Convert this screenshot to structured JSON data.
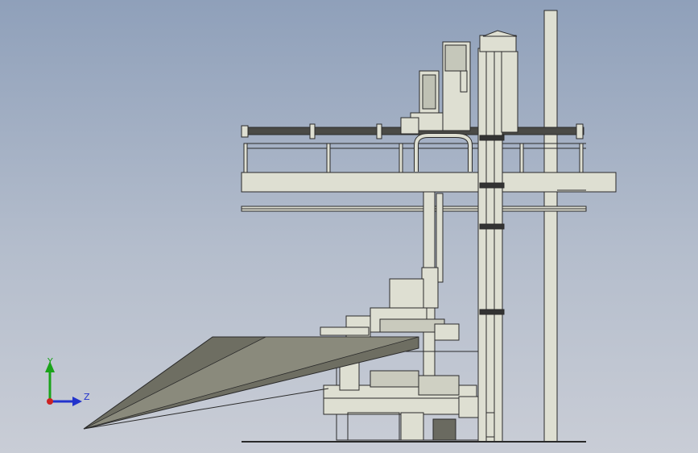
{
  "viewport": {
    "background_top": "#8fa0ba",
    "background_bottom": "#c9cdd6"
  },
  "triad": {
    "y_label": "Y",
    "z_label": "Z",
    "y_color": "#1aa31a",
    "z_color": "#2233cc",
    "x_color": "#cc2222"
  },
  "model": {
    "line_color": "#2a2a2a",
    "fill_color": "#dedfd2",
    "conveyor_color": "#6e6e62"
  }
}
